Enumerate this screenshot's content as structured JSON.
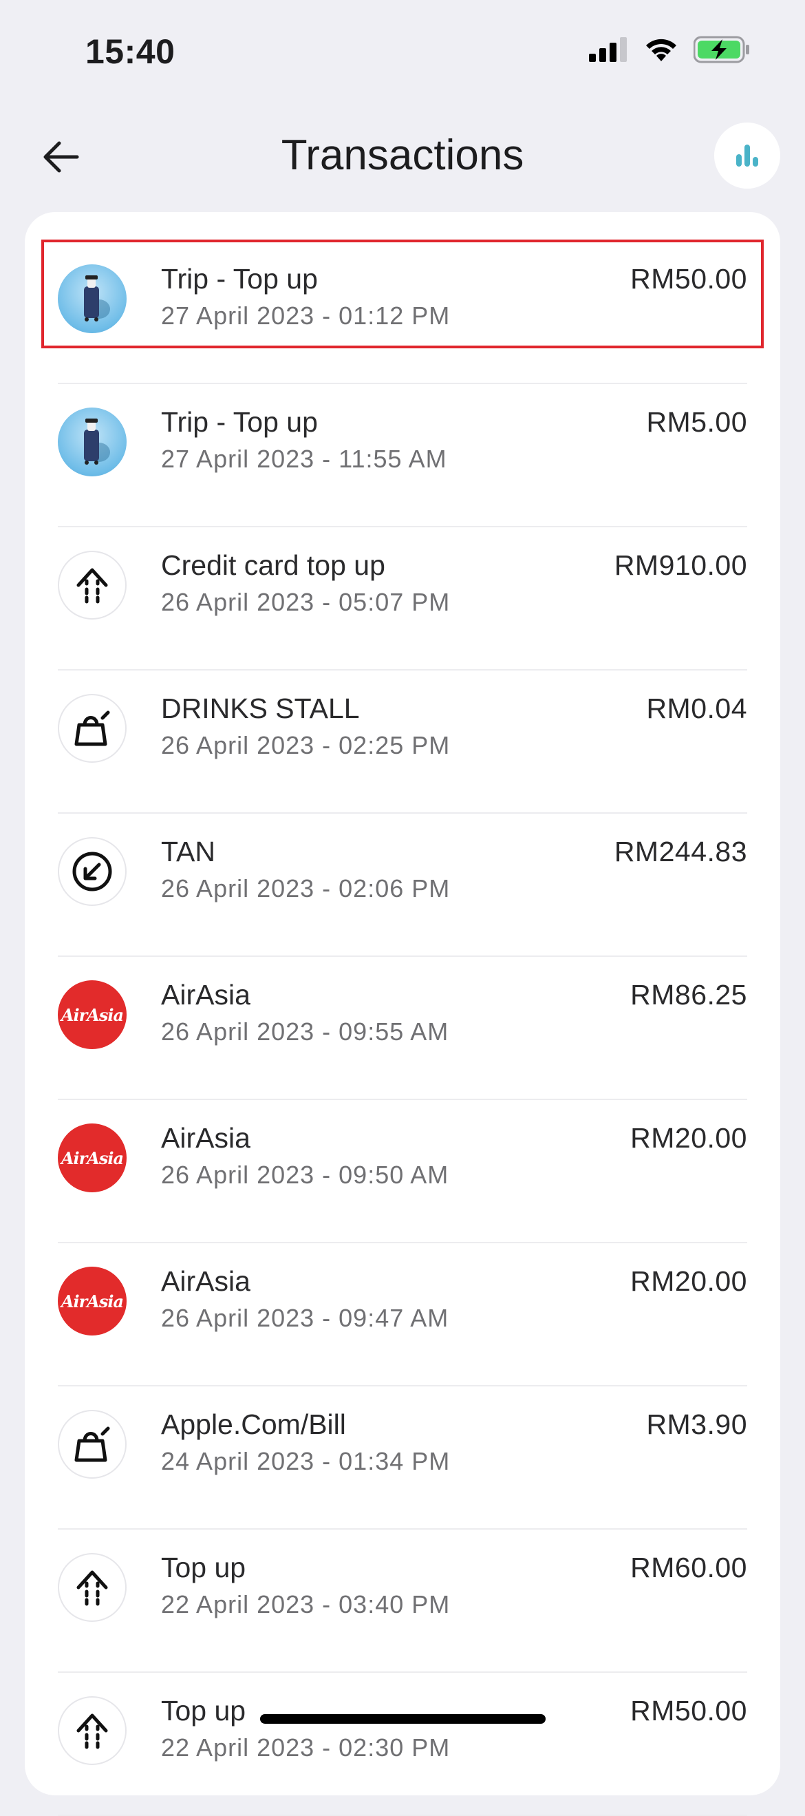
{
  "status": {
    "time": "15:40"
  },
  "header": {
    "title": "Transactions"
  },
  "transactions": [
    {
      "title": "Trip - Top up",
      "date": "27 April 2023 - 01:12 PM",
      "amount": "RM50.00",
      "icon": "trip-icon"
    },
    {
      "title": "Trip - Top up",
      "date": "27 April 2023 - 11:55 AM",
      "amount": "RM5.00",
      "icon": "trip-icon"
    },
    {
      "title": "Credit card top up",
      "date": "26 April 2023 - 05:07 PM",
      "amount": "RM910.00",
      "icon": "topup-arrow-icon"
    },
    {
      "title": "DRINKS STALL",
      "date": "26 April 2023 - 02:25 PM",
      "amount": "RM0.04",
      "icon": "shopping-bag-icon"
    },
    {
      "title": "TAN",
      "date": "26 April 2023 - 02:06 PM",
      "amount": "RM244.83",
      "icon": "receive-arrow-icon"
    },
    {
      "title": "AirAsia",
      "date": "26 April 2023 - 09:55 AM",
      "amount": "RM86.25",
      "icon": "airasia-logo",
      "logo_text": "AirAsia"
    },
    {
      "title": "AirAsia",
      "date": "26 April 2023 - 09:50 AM",
      "amount": "RM20.00",
      "icon": "airasia-logo",
      "logo_text": "AirAsia"
    },
    {
      "title": "AirAsia",
      "date": "26 April 2023 - 09:47 AM",
      "amount": "RM20.00",
      "icon": "airasia-logo",
      "logo_text": "AirAsia"
    },
    {
      "title": "Apple.Com/Bill",
      "date": "24 April 2023 - 01:34 PM",
      "amount": "RM3.90",
      "icon": "shopping-bag-icon"
    },
    {
      "title": "Top up",
      "date": "22 April 2023 - 03:40 PM",
      "amount": "RM60.00",
      "icon": "topup-arrow-icon"
    },
    {
      "title": "Top up",
      "date": "22 April 2023 - 02:30 PM",
      "amount": "RM50.00",
      "icon": "topup-arrow-icon"
    }
  ],
  "colors": {
    "accent": "#4ab3c8",
    "highlight": "#e0262d",
    "airasia": "#e22b2b",
    "battery": "#4cd964"
  }
}
